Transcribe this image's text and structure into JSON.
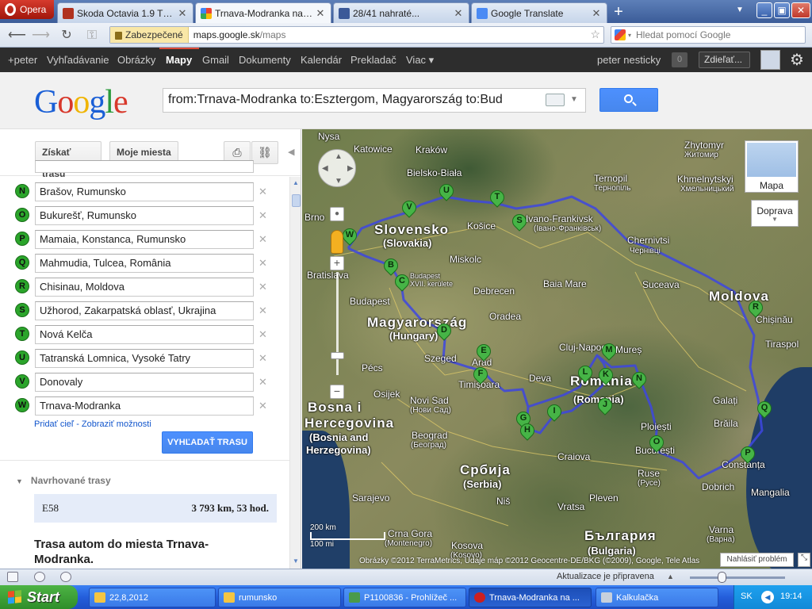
{
  "browser": {
    "menu_label": "Opera",
    "tabs": [
      {
        "title": "Skoda Octavia 1.9 TDI P...",
        "icon_color": "#b0321f"
      },
      {
        "title": "Trnava-Modranka na Trn...",
        "icon_color": "#4285f4"
      },
      {
        "title": "28/41 nahraté...",
        "icon_color": "#3b5998"
      },
      {
        "title": "Google Translate",
        "icon_color": "#4a8af4"
      }
    ],
    "new_tab_label": "+",
    "tab_menu_caret": "▼",
    "window_controls": {
      "minimize": "_",
      "maximize": "▣",
      "close": "✕"
    },
    "secure_label": "Zabezpečené",
    "url_host": "maps.google.sk",
    "url_path": "/maps",
    "search_placeholder": "Hledat pomocí Google",
    "status_text": "Aktualizace je připravena"
  },
  "gbar": {
    "items": [
      "+peter",
      "Vyhľadávanie",
      "Obrázky",
      "Mapy",
      "Gmail",
      "Dokumenty",
      "Kalendár",
      "Prekladač",
      "Viac ▾"
    ],
    "user_name": "peter nesticky",
    "notif_count": "0",
    "share_label": "Zdieľať..."
  },
  "search": {
    "logo": "Google",
    "query": "from:Trnava-Modranka to:Esztergom, Magyarország to:Bud"
  },
  "panel": {
    "get_directions": "Získať trasu",
    "my_places": "Moje miesta",
    "waypoints": [
      {
        "letter": "N",
        "value": "Brašov, Rumunsko"
      },
      {
        "letter": "O",
        "value": "Bukurešť, Rumunsko"
      },
      {
        "letter": "P",
        "value": "Mamaia, Konstanca, Rumunsko"
      },
      {
        "letter": "Q",
        "value": "Mahmudia, Tulcea, România"
      },
      {
        "letter": "R",
        "value": "Chisinau, Moldova"
      },
      {
        "letter": "S",
        "value": "Užhorod, Zakarpatská oblasť, Ukrajina"
      },
      {
        "letter": "T",
        "value": "Nová Kelča"
      },
      {
        "letter": "U",
        "value": "Tatranská Lomnica, Vysoké Tatry"
      },
      {
        "letter": "V",
        "value": "Donovaly"
      },
      {
        "letter": "W",
        "value": "Trnava-Modranka"
      }
    ],
    "add_destination": "Pridať cieľ",
    "link_separator": " - ",
    "show_options": "Zobraziť možnosti",
    "search_route_button": "VYHĽADAŤ TRASU",
    "suggested_title": "Navrhované trasy",
    "route": {
      "name": "E58",
      "summary": "3 793 km, 53 hod."
    },
    "route_heading": "Trasa autom do miesta Trnava-Modranka."
  },
  "map": {
    "type_button": "Mapa",
    "traffic_button": "Doprava",
    "scale_km": "200 km",
    "scale_mi": "100 mi",
    "copyright": "Obrázky ©2012 TerraMetrics, Údaje máp ©2012 Geocentre-DE/BKG (©2009), Google, Tele Atlas",
    "report_problem": "Nahlásiť problém",
    "labels": {
      "nysa": "Nysa",
      "katowice": "Katowice",
      "krakow": "Kraków",
      "bielsko": "Bielsko-Biała",
      "ternopil": "Ternopil",
      "ternopil_cyr": "Тернопіль",
      "zhytomyr": "Zhytomyr",
      "zhytomyr_cyr": "Житомир",
      "khmelnytskyi": "Khmelnytskyi",
      "khmelnytskyi_cyr": "Хмельницький",
      "brno": "Brno",
      "slovensko": "Slovensko",
      "slovakia": "(Slovakia)",
      "kosice": "Košice",
      "ivano": "Ivano-Frankivsk",
      "ivano_cyr": "(Івано-Франківськ)",
      "chernivtsi": "Chernivtsi",
      "chernivtsi_cyr": "Чернівці",
      "bratislava": "Bratislava",
      "miskolc": "Miskolc",
      "baia_mare": "Baia Mare",
      "suceava": "Suceava",
      "moldova": "Moldova",
      "chisinau": "Chișinău",
      "budapest": "Budapest",
      "budapest_xvii": "Budapest XVII. kerülete",
      "debrecen": "Debrecen",
      "oradea": "Oradea",
      "magyarorszag": "Magyarország",
      "hungary": "(Hungary)",
      "cluj": "Cluj-Napoca",
      "mures": "Mureș",
      "tiraspol": "Tiraspol",
      "pecs": "Pécs",
      "szeged": "Szeged",
      "arad": "Arad",
      "romania": "România",
      "romania_en": "(Romania)",
      "osijek": "Osijek",
      "timisoara": "Timișoara",
      "deva": "Deva",
      "novi_sad": "Novi Sad",
      "novi_sad_cyr": "(Нови Сад)",
      "galati": "Galați",
      "ploiesti": "Ploiești",
      "braila": "Brăila",
      "bosna": "Bosna i",
      "hercegovina": "Hercegovina",
      "bosnia": "(Bosnia and",
      "herzegovina": "Herzegovina)",
      "beograd": "Beograd",
      "beograd_cyr": "(Београд)",
      "craiova": "Craiova",
      "bucuresti": "București",
      "constanta": "Constanța",
      "srbija": "Србија",
      "serbia": "(Serbia)",
      "ruse": "Ruse",
      "ruse_cyr": "(Русе)",
      "dobrich": "Dobrich",
      "sarajevo": "Sarajevo",
      "nis": "Niš",
      "vratsa": "Vratsa",
      "pleven": "Pleven",
      "mangalia": "Mangalia",
      "crna_gora": "Crna Gora",
      "montenegro": "(Montenegro)",
      "kosova": "Kosova",
      "kosovo": "(Kosovo)",
      "balgaria": "България",
      "bulgaria": "(Bulgaria)",
      "varna": "Varna",
      "varna_cyr": "(Варна)"
    },
    "pins": [
      "B",
      "C",
      "D",
      "E",
      "F",
      "G",
      "H",
      "I",
      "J",
      "K",
      "L",
      "M",
      "N",
      "O",
      "P",
      "Q",
      "R",
      "S",
      "T",
      "U",
      "V",
      "W"
    ]
  },
  "taskbar": {
    "start_label": "Start",
    "items": [
      {
        "label": "22,8,2012",
        "icon_color": "#f4c542"
      },
      {
        "label": "rumunsko",
        "icon_color": "#f4c542"
      },
      {
        "label": "P1100836 - Prohlížeč ...",
        "icon_color": "#4a9a4a"
      },
      {
        "label": "Trnava-Modranka na ...",
        "icon_color": "#cc1f1f"
      },
      {
        "label": "Kalkulačka",
        "icon_color": "#c7d0dc"
      }
    ],
    "lang": "SK",
    "time": "19:14"
  },
  "colors": {
    "accent_blue": "#4787ed",
    "route_line": "#3d46e0",
    "pin_green": "#46b446"
  }
}
